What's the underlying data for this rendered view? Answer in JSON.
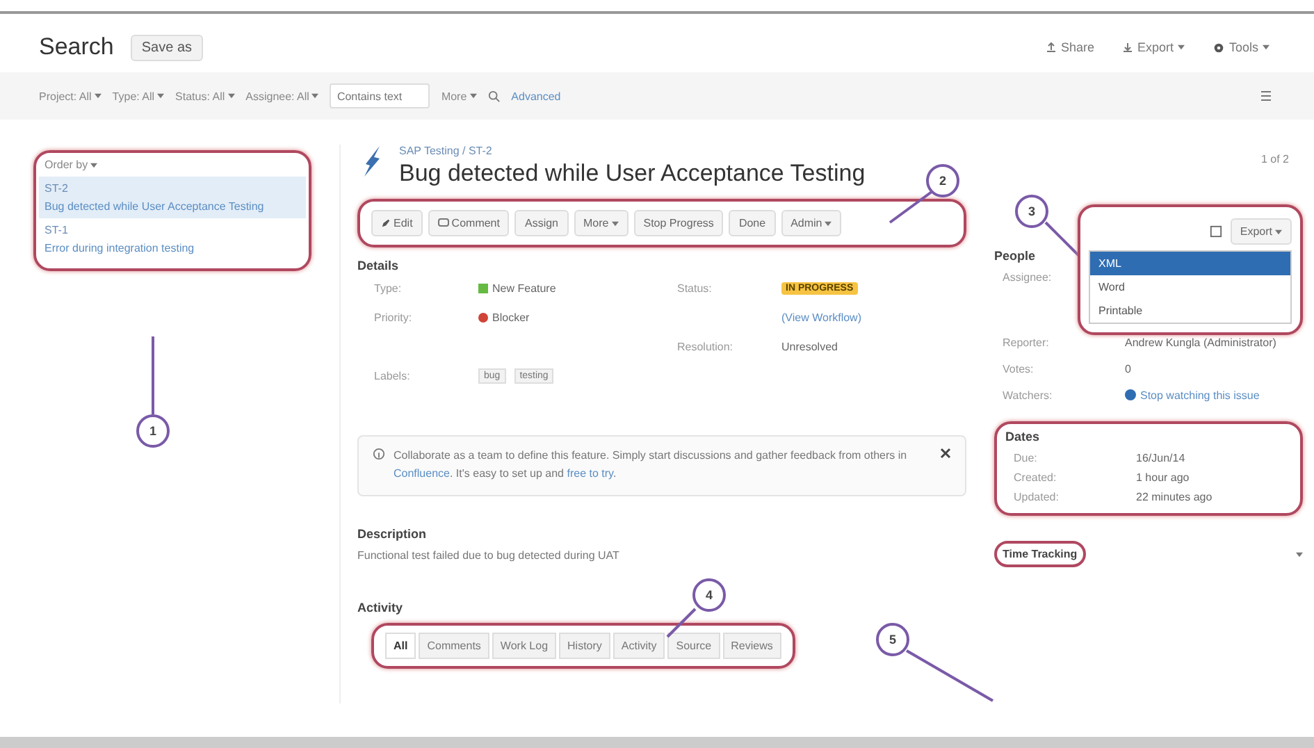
{
  "header": {
    "title": "Search",
    "save_button": "Save as",
    "actions": [
      "Share",
      "Export",
      "Tools"
    ]
  },
  "filters": {
    "dropdowns": [
      "Project: All",
      "Type: All",
      "Status: All",
      "Assignee: All"
    ],
    "search": {
      "placeholder": "Contains text"
    },
    "more": "More",
    "advanced": "Advanced"
  },
  "issue_list": {
    "order": "Order by",
    "issues": [
      {
        "key": "ST-2",
        "summary": "Bug detected while User Acceptance Testing",
        "selected": true
      },
      {
        "key": "ST-1",
        "summary": "Error during integration testing",
        "selected": false
      }
    ]
  },
  "issue": {
    "breadcrumb": "SAP Testing / ST-2",
    "title": "Bug detected while User Acceptance Testing",
    "toolbar": [
      {
        "label": "Edit",
        "kind": "edit"
      },
      {
        "label": "Comment",
        "kind": "comment"
      },
      {
        "label": "Assign",
        "kind": "plain"
      },
      {
        "label": "More",
        "kind": "menu"
      },
      {
        "label": "Stop Progress",
        "kind": "plain"
      },
      {
        "label": "Done",
        "kind": "plain"
      },
      {
        "label": "Admin",
        "kind": "menu"
      }
    ],
    "details_heading": "Details",
    "details_left": [
      {
        "label": "Type:",
        "value": "New Feature",
        "kind": "type"
      },
      {
        "label": "Priority:",
        "value": "Blocker",
        "kind": "priority"
      }
    ],
    "details_right": [
      {
        "label": "Status:",
        "value": "IN PROGRESS",
        "kind": "status"
      },
      {
        "value": "(View Workflow)",
        "kind": "link"
      },
      {
        "label": "Resolution:",
        "value": "Unresolved",
        "kind": "plain"
      }
    ],
    "labels": {
      "label": "Labels:",
      "values": [
        "bug",
        "testing"
      ]
    },
    "info": [
      {
        "text": "Collaborate as a team to define this feature. Simply start discussions and gather feedback from others in ",
        "kind": "text"
      },
      {
        "text": "Confluence",
        "kind": "link"
      },
      {
        "text": ". It's easy to set up and ",
        "kind": "text"
      },
      {
        "text": "free to try",
        "kind": "link"
      },
      {
        "text": ".",
        "kind": "text"
      }
    ],
    "description_heading": "Description",
    "description": "Functional test failed due to bug detected during UAT",
    "activity_heading": "Activity",
    "activity_tabs": [
      {
        "label": "All",
        "selected": true
      },
      {
        "label": "Comments",
        "selected": false
      },
      {
        "label": "Work Log",
        "selected": false
      },
      {
        "label": "History",
        "selected": false
      },
      {
        "label": "Activity",
        "selected": false
      },
      {
        "label": "Source",
        "selected": false
      },
      {
        "label": "Reviews",
        "selected": false
      }
    ]
  },
  "side": {
    "pager": "1 of 2",
    "export": "Export",
    "export_menu": [
      {
        "label": "XML",
        "selected": true
      },
      {
        "label": "Word",
        "selected": false
      },
      {
        "label": "Printable",
        "selected": false
      }
    ],
    "people_heading": "People",
    "people": [
      {
        "label": "Assignee:",
        "kind": "plain"
      },
      {
        "label": "Reporter:",
        "value": "Andrew Kungla (Administrator)",
        "kind": "user"
      },
      {
        "label": "Votes:",
        "value": "0",
        "kind": "plain"
      },
      {
        "label": "Watchers:",
        "value": "Stop watching this issue",
        "kind": "watch"
      }
    ],
    "dates_heading": "Dates",
    "dates": [
      {
        "label": "Due:",
        "value": "16/Jun/14"
      },
      {
        "label": "Created:",
        "value": "1 hour ago"
      },
      {
        "label": "Updated:",
        "value": "22 minutes ago"
      }
    ],
    "time_tracking": "Time Tracking"
  },
  "callouts": [
    "1",
    "2",
    "3",
    "4",
    "5"
  ]
}
